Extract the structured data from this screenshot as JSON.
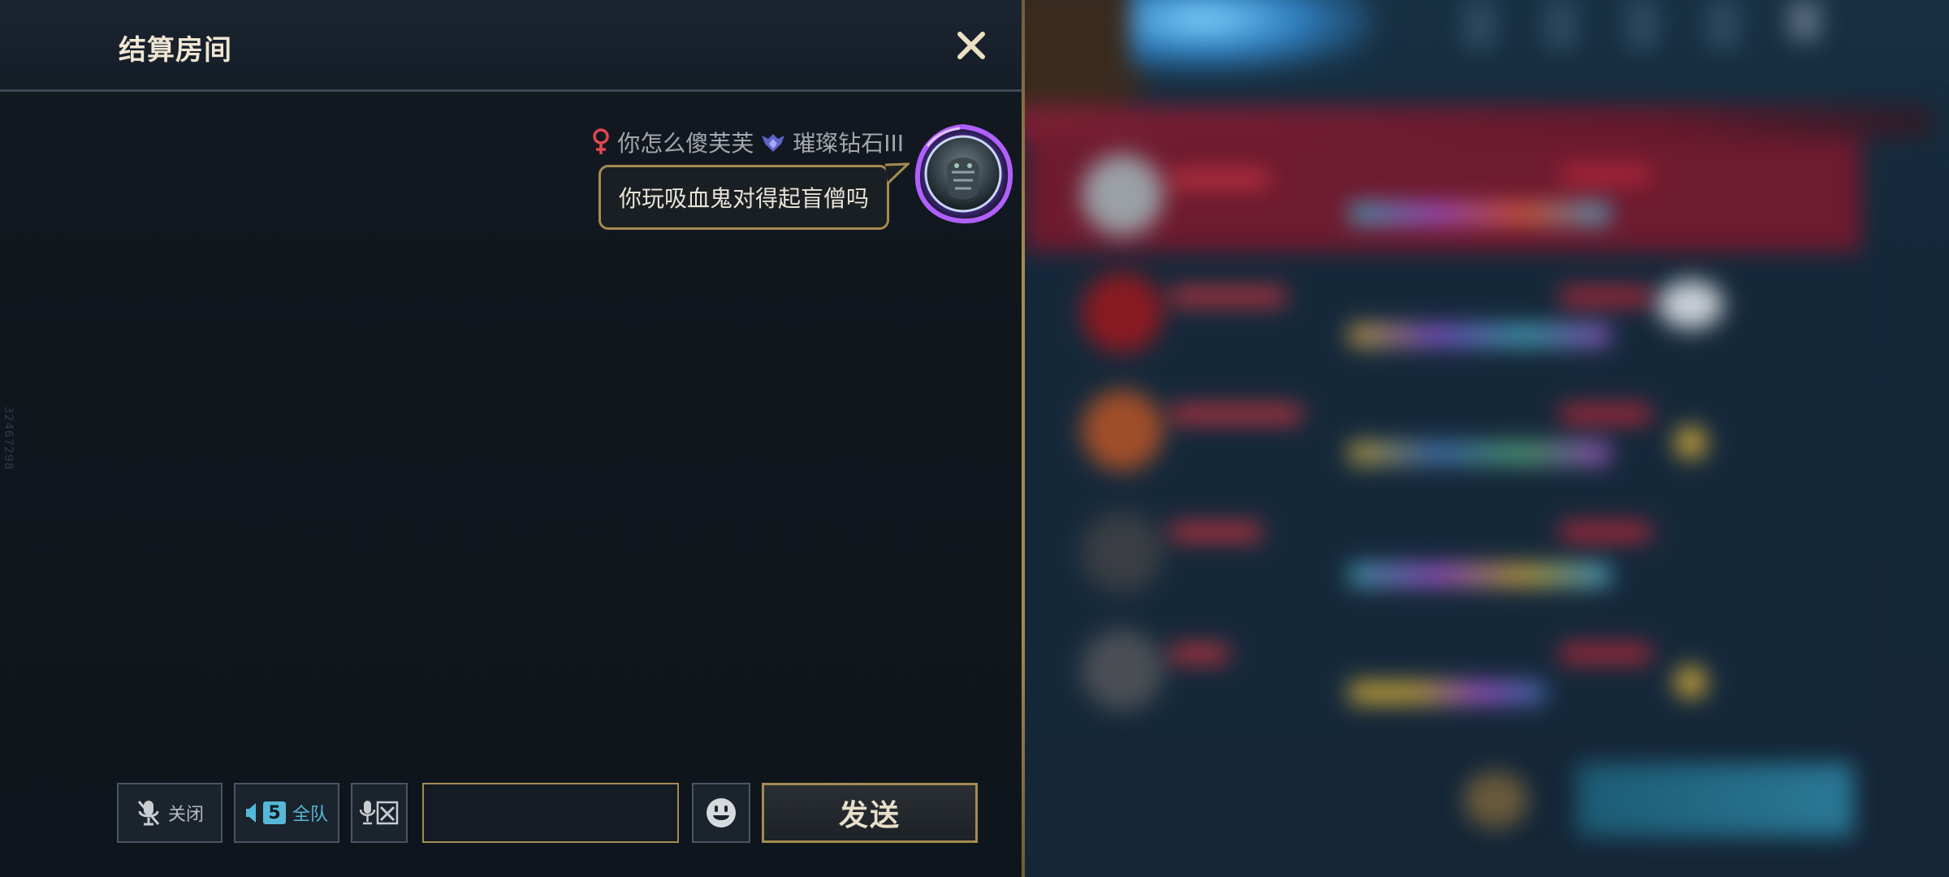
{
  "header": {
    "title": "结算房间"
  },
  "side_id": "32467298",
  "message": {
    "sender_name": "你怎么傻芙芙",
    "rank": "璀璨钻石III",
    "text": "你玩吸血鬼对得起盲僧吗",
    "icons": {
      "gender": "female-symbol-icon",
      "rank": "diamond-rank-icon",
      "avatar": "player-avatar"
    }
  },
  "toolbar": {
    "mic_label": "关闭",
    "team_count": "5",
    "team_label": "全队",
    "input_value": "",
    "send_label": "发送",
    "icons": {
      "mic": "microphone-off-icon",
      "speaker": "speaker-icon",
      "voice_to_text": "voice-to-text-icon",
      "emoji": "emoji-icon"
    }
  },
  "colors": {
    "accent_gold": "#a48b52",
    "team_blue": "#55b8d8",
    "female_red": "#e2474f",
    "rank_purple": "#7f78e6"
  }
}
